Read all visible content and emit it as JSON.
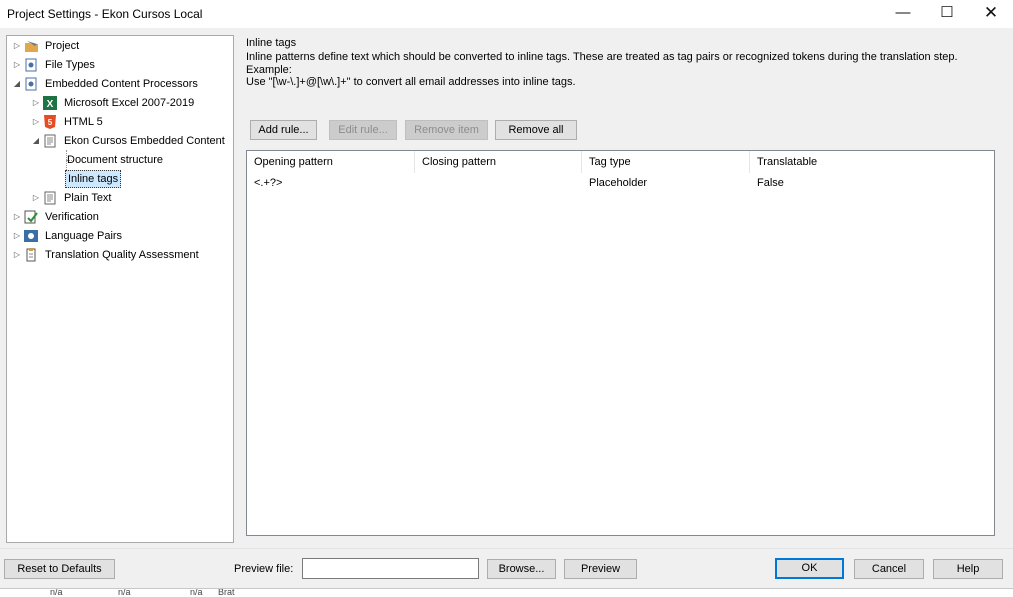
{
  "window": {
    "title": "Project Settings - Ekon Cursos Local",
    "minimize": "—",
    "maximize": "☐",
    "close": "✕"
  },
  "tree": {
    "items": [
      {
        "label": "Project",
        "icon": "project-icon",
        "expander": "▷"
      },
      {
        "label": "File Types",
        "icon": "file-types-icon",
        "expander": "▷"
      },
      {
        "label": "Embedded Content Processors",
        "icon": "embedded-content-icon",
        "expander": "◢"
      },
      {
        "label": "Microsoft Excel 2007-2019",
        "icon": "excel-icon",
        "expander": "▷"
      },
      {
        "label": "HTML 5",
        "icon": "html5-icon",
        "expander": "▷"
      },
      {
        "label": "Ekon Cursos Embedded Content",
        "icon": "document-icon",
        "expander": "◢"
      },
      {
        "label": "Document structure",
        "icon": "",
        "expander": ""
      },
      {
        "label": "Inline tags",
        "icon": "",
        "expander": ""
      },
      {
        "label": "Plain Text",
        "icon": "document-icon",
        "expander": "▷"
      },
      {
        "label": "Verification",
        "icon": "verification-icon",
        "expander": "▷"
      },
      {
        "label": "Language Pairs",
        "icon": "language-pairs-icon",
        "expander": "▷"
      },
      {
        "label": "Translation Quality Assessment",
        "icon": "tqa-icon",
        "expander": "▷"
      }
    ],
    "selected": "Inline tags"
  },
  "panel": {
    "title": "Inline tags",
    "description_line1": "Inline patterns define text which should be converted to inline tags. These are treated as tag pairs or recognized tokens during the translation step.",
    "description_line2": "Example:",
    "description_line3": "Use \"[\\w-\\.]+@[\\w\\.]+\" to convert all email addresses into inline tags."
  },
  "toolbar": {
    "add_rule": "Add rule...",
    "edit_rule": "Edit rule...",
    "remove_item": "Remove item",
    "remove_all": "Remove all"
  },
  "table": {
    "columns": [
      "Opening pattern",
      "Closing pattern",
      "Tag type",
      "Translatable"
    ],
    "rows": [
      {
        "opening": "<.+?>",
        "closing": "",
        "tag_type": "Placeholder",
        "translatable": "False"
      }
    ]
  },
  "footer": {
    "reset": "Reset to Defaults",
    "preview_label": "Preview file:",
    "preview_value": "",
    "browse": "Browse...",
    "preview": "Preview",
    "ok": "OK",
    "cancel": "Cancel",
    "help": "Help"
  },
  "background_window": {
    "cell1": "n/a",
    "cell2": "n/a",
    "cell3": "Brat",
    "cell4": "n/a"
  },
  "colors": {
    "accent": "#0078d7",
    "selection": "#cce8ff"
  }
}
